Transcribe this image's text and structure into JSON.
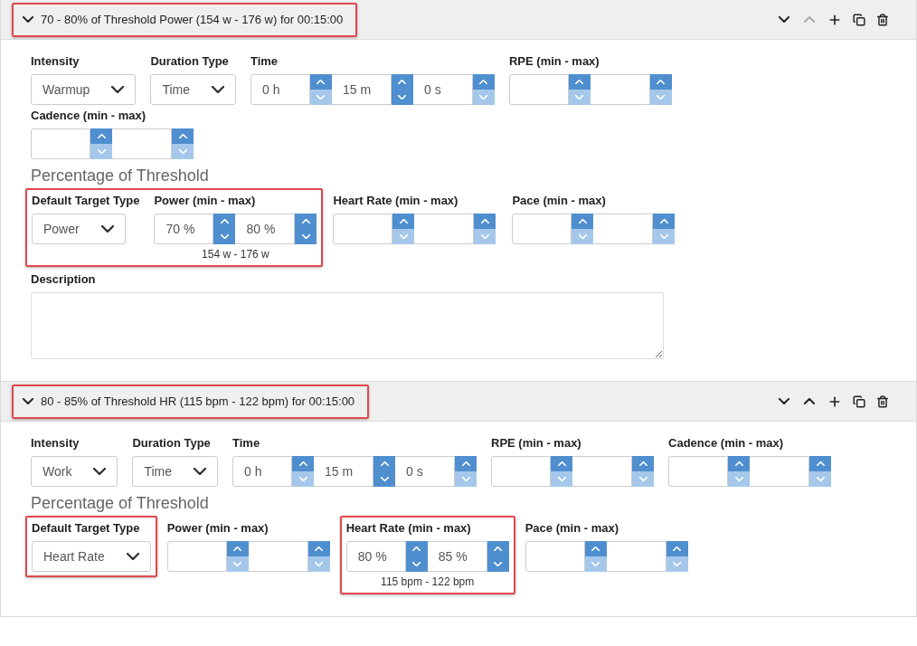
{
  "sections": [
    {
      "title": "70 - 80% of Threshold Power (154 w - 176 w) for 00:15:00",
      "expanded": true,
      "highlighted": true,
      "move_up_disabled": true,
      "fields": [
        {
          "kind": "select",
          "label": "Intensity",
          "value": "Warmup"
        },
        {
          "kind": "select",
          "label": "Duration Type",
          "value": "Time"
        },
        {
          "kind": "spinners",
          "label": "Time",
          "inputs": [
            {
              "value": "0 h",
              "down_disabled": true
            },
            {
              "value": "15 m",
              "down_disabled": false
            },
            {
              "value": "0 s",
              "down_disabled": true
            }
          ]
        },
        {
          "kind": "spinners",
          "label": "RPE (min - max)",
          "inputs": [
            {
              "down_disabled": true
            },
            {
              "down_disabled": true
            }
          ]
        },
        {
          "kind": "spinners",
          "label": "Cadence (min - max)",
          "inputs": [
            {
              "down_disabled": true
            },
            {
              "down_disabled": true
            }
          ]
        }
      ],
      "threshold_heading": "Percentage of Threshold",
      "threshold_groups": [
        {
          "highlighted": true,
          "fields": [
            {
              "kind": "select",
              "label": "Default Target Type",
              "value": "Power"
            },
            {
              "kind": "spinners",
              "label": "Power (min - max)",
              "inputs": [
                {
                  "value": "70 %",
                  "down_disabled": false
                },
                {
                  "value": "80 %",
                  "down_disabled": false
                }
              ],
              "note": "154 w - 176 w"
            }
          ]
        },
        {
          "highlighted": false,
          "fields": [
            {
              "kind": "spinners",
              "label": "Heart Rate (min - max)",
              "inputs": [
                {
                  "down_disabled": true
                },
                {
                  "down_disabled": true
                }
              ]
            }
          ]
        },
        {
          "highlighted": false,
          "fields": [
            {
              "kind": "spinners",
              "label": "Pace (min - max)",
              "inputs": [
                {
                  "down_disabled": true
                },
                {
                  "down_disabled": true
                }
              ]
            }
          ]
        }
      ],
      "description": {
        "label": "Description"
      }
    },
    {
      "title": "80 - 85% of Threshold HR (115 bpm - 122 bpm) for 00:15:00",
      "expanded": true,
      "highlighted": true,
      "move_up_disabled": false,
      "fields": [
        {
          "kind": "select",
          "label": "Intensity",
          "value": "Work"
        },
        {
          "kind": "select",
          "label": "Duration Type",
          "value": "Time"
        },
        {
          "kind": "spinners",
          "label": "Time",
          "inputs": [
            {
              "value": "0 h",
              "down_disabled": true
            },
            {
              "value": "15 m",
              "down_disabled": false
            },
            {
              "value": "0 s",
              "down_disabled": true
            }
          ]
        },
        {
          "kind": "spinners",
          "label": "RPE (min - max)",
          "inputs": [
            {
              "down_disabled": true
            },
            {
              "down_disabled": true
            }
          ]
        },
        {
          "kind": "spinners",
          "label": "Cadence (min - max)",
          "inputs": [
            {
              "down_disabled": true
            },
            {
              "down_disabled": true
            }
          ]
        }
      ],
      "threshold_heading": "Percentage of Threshold",
      "threshold_groups": [
        {
          "highlighted": true,
          "fields": [
            {
              "kind": "select",
              "label": "Default Target Type",
              "value": "Heart Rate"
            }
          ]
        },
        {
          "highlighted": false,
          "fields": [
            {
              "kind": "spinners",
              "label": "Power (min - max)",
              "inputs": [
                {
                  "down_disabled": true
                },
                {
                  "down_disabled": true
                }
              ]
            }
          ]
        },
        {
          "highlighted": true,
          "fields": [
            {
              "kind": "spinners",
              "label": "Heart Rate (min - max)",
              "inputs": [
                {
                  "value": "80 %",
                  "down_disabled": false
                },
                {
                  "value": "85 %",
                  "down_disabled": false
                }
              ],
              "note": "115 bpm - 122 bpm"
            }
          ]
        },
        {
          "highlighted": false,
          "fields": [
            {
              "kind": "spinners",
              "label": "Pace (min - max)",
              "inputs": [
                {
                  "down_disabled": true
                },
                {
                  "down_disabled": true
                }
              ]
            }
          ]
        }
      ]
    }
  ]
}
